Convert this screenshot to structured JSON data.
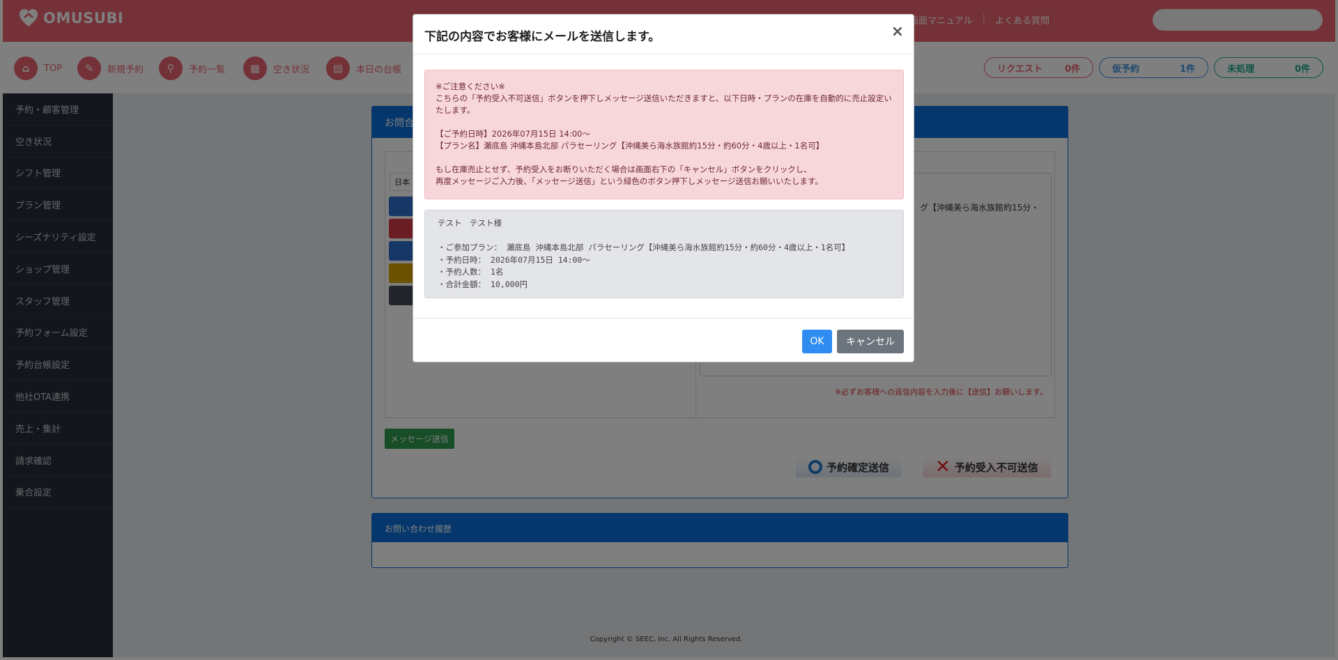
{
  "header": {
    "brand": "OMUSUBI",
    "links": [
      "管理画面マニュアル",
      "よくある質問"
    ],
    "search_placeholder": ""
  },
  "nav": {
    "items": [
      {
        "label": "TOP",
        "icon": "home-icon"
      },
      {
        "label": "新規予約",
        "icon": "edit-icon"
      },
      {
        "label": "予約一覧",
        "icon": "search-icon"
      },
      {
        "label": "空き状況",
        "icon": "grid-icon"
      },
      {
        "label": "本日の台帳",
        "icon": "book-icon"
      }
    ],
    "status": [
      {
        "label": "リクエスト",
        "count": "0件",
        "color": "#e8636f"
      },
      {
        "label": "仮予約",
        "count": "1件",
        "color": "#3a8fe0"
      },
      {
        "label": "未処理",
        "count": "0件",
        "color": "#1aa888"
      }
    ]
  },
  "sidebar": {
    "items": [
      "予約・顧客管理",
      "空き状況",
      "シフト管理",
      "プラン管理",
      "シーズナリティ設定",
      "ショップ管理",
      "スタッフ管理",
      "予約フォーム設定",
      "予約台帳設定",
      "他社OTA連携",
      "売上・集計",
      "請求確認",
      "乗合設定"
    ]
  },
  "main": {
    "card_title": "お問合",
    "lang_tab": "日本",
    "reply_text": "グ【沖縄美ら海水族館約15分・",
    "reply_note": "※必ずお客様への返信内容を入力後に【送信】お願いします。",
    "message_send_label": "メッセージ送信",
    "confirm_label": "予約確定送信",
    "reject_label": "予約受入不可送信",
    "history_title": "お問い合わせ履歴",
    "copyright": "Copyright © SEEC, Inc. All Rights Reserved."
  },
  "modal": {
    "title": "下記の内容でお客様にメールを送信します。",
    "close": "×",
    "alert": {
      "line1": "※ご注意ください※",
      "line2": "こちらの「予約受入不可送信」ボタンを押下しメッセージ送信いただきますと、以下日時・プランの在庫を自動的に売止設定い",
      "line3": "たします。",
      "line4": "【ご予約日時】2026年07月15日 14:00〜",
      "line5": "【プラン名】瀬底島 沖縄本島北部 パラセーリング【沖縄美ら海水族館約15分・約60分・4歳以上・1名可】",
      "line6": "もし在庫売止とせず、予約受入をお断りいただく場合は画面右下の「キャンセル」ボタンをクリックし、",
      "line7": "再度メッセージご入力後、「メッセージ送信」という緑色のボタン押下しメッセージ送信お願いいたします。"
    },
    "info": {
      "line1": "テスト　テスト様",
      "line2": "・ご参加プラン： 瀬底島 沖縄本島北部 パラセーリング【沖縄美ら海水族館約15分・約60分・4歳以上・1名可】",
      "line3": "・予約日時： 2026年07月15日 14:00〜",
      "line4": "・予約人数： 1名",
      "line5": "・合計金額： 10,000円"
    },
    "ok_label": "OK",
    "cancel_label": "キャンセル"
  },
  "colors": {
    "brand": "#e8636f",
    "primary": "#0a6ed8",
    "ok_button": "#2f8cf0",
    "cancel_button": "#6c757d",
    "send_button": "#2e9b4f"
  }
}
